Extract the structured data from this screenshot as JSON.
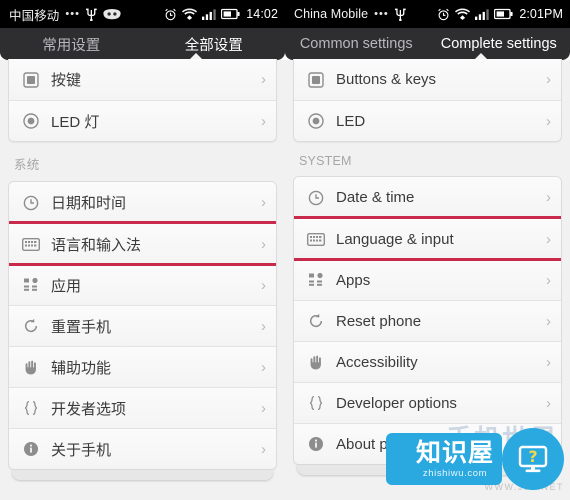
{
  "screens": [
    {
      "id": "chinese",
      "statusbar": {
        "carrier": "中国移动",
        "dots": "•••",
        "usb_icon": "usb-icon",
        "face_icon": "robot-face-icon",
        "alarm_icon": "alarm-clock-icon",
        "wifi_icon": "wifi-icon",
        "signal_icon": "signal-bars-icon",
        "battery_icon": "battery-icon",
        "clock": "14:02"
      },
      "tabs": [
        {
          "label": "常用设置",
          "active": false
        },
        {
          "label": "全部设置",
          "active": true
        }
      ],
      "groups": [
        {
          "section": null,
          "items": [
            {
              "icon": "buttons-keys-icon",
              "label": "按键",
              "chevron": "›",
              "highlighted": false
            },
            {
              "icon": "led-icon",
              "label": "LED 灯",
              "chevron": "›",
              "highlighted": false
            }
          ]
        },
        {
          "section": "系统",
          "items": [
            {
              "icon": "clock-icon",
              "label": "日期和时间",
              "chevron": "›",
              "highlighted": false
            },
            {
              "icon": "keyboard-icon",
              "label": "语言和输入法",
              "chevron": "›",
              "highlighted": true
            },
            {
              "icon": "apps-grid-icon",
              "label": "应用",
              "chevron": "›",
              "highlighted": false
            },
            {
              "icon": "reset-icon",
              "label": "重置手机",
              "chevron": "›",
              "highlighted": false
            },
            {
              "icon": "hand-icon",
              "label": "辅助功能",
              "chevron": "›",
              "highlighted": false
            },
            {
              "icon": "braces-icon",
              "label": "开发者选项",
              "chevron": "›",
              "highlighted": false
            },
            {
              "icon": "info-icon",
              "label": "关于手机",
              "chevron": "›",
              "highlighted": false
            }
          ]
        }
      ]
    },
    {
      "id": "english",
      "statusbar": {
        "carrier": "China Mobile",
        "dots": "•••",
        "usb_icon": "usb-icon",
        "face_icon": "",
        "alarm_icon": "alarm-clock-icon",
        "wifi_icon": "wifi-icon",
        "signal_icon": "signal-bars-icon",
        "battery_icon": "battery-icon",
        "clock": "2:01PM"
      },
      "tabs": [
        {
          "label": "Common settings",
          "active": false
        },
        {
          "label": "Complete settings",
          "active": true
        }
      ],
      "groups": [
        {
          "section": null,
          "items": [
            {
              "icon": "buttons-keys-icon",
              "label": "Buttons & keys",
              "chevron": "›",
              "highlighted": false
            },
            {
              "icon": "led-icon",
              "label": "LED",
              "chevron": "›",
              "highlighted": false
            }
          ]
        },
        {
          "section": "SYSTEM",
          "items": [
            {
              "icon": "clock-icon",
              "label": "Date & time",
              "chevron": "›",
              "highlighted": false
            },
            {
              "icon": "keyboard-icon",
              "label": "Language & input",
              "chevron": "›",
              "highlighted": true
            },
            {
              "icon": "apps-grid-icon",
              "label": "Apps",
              "chevron": "›",
              "highlighted": false
            },
            {
              "icon": "reset-icon",
              "label": "Reset phone",
              "chevron": "›",
              "highlighted": false
            },
            {
              "icon": "hand-icon",
              "label": "Accessibility",
              "chevron": "›",
              "highlighted": false
            },
            {
              "icon": "braces-icon",
              "label": "Developer options",
              "chevron": "›",
              "highlighted": false
            },
            {
              "icon": "info-icon",
              "label": "About phone",
              "chevron": "›",
              "highlighted": false
            }
          ]
        }
      ]
    }
  ],
  "watermark": {
    "ghost_text": "手机世界",
    "faint_url": "WWW.JJS.NET",
    "logo_cn": "知识屋",
    "logo_domain": "zhishiwu.com",
    "logo_glyph": "?",
    "accent_color": "#2aa8e0"
  },
  "colors": {
    "highlight_red": "#c9294b",
    "tabbar_bg": "#2e2e31",
    "statusbar_bg": "#000000"
  }
}
